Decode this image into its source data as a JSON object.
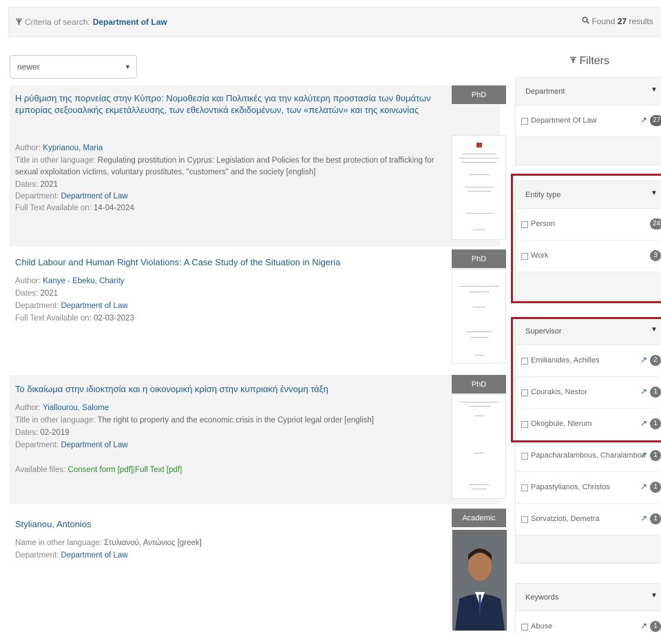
{
  "criteria": {
    "label": "Criteria of search:",
    "term": "Department of Law",
    "found_prefix": "Found",
    "found_count": "27",
    "found_suffix": "results"
  },
  "sort": {
    "selected": "newer"
  },
  "filters_title": "Filters",
  "results": [
    {
      "badge": "PhD",
      "title": "Η ρύθμιση της πορνείας στην Κύπρο: Νομοθεσία και Πολιτικές για την καλύτερη προστασία των θυμάτων εμπορίας σεξουαλικής εκμετάλλευσης, των εθελοντικά εκδιδομένων, των «πελατών» και της κοινωνίας",
      "author_label": "Author:",
      "author": "Kyprianou, Maria",
      "other_label": "Title in other language:",
      "other": "Regulating prostitution in Cyprus: Legislation and Policies for the best protection of trafficking for sexual exploitation victims, voluntary prostitutes, \"customers\" and the society [english]",
      "dates_label": "Dates:",
      "dates": "2021",
      "dept_label": "Department:",
      "dept": "Department of Law",
      "fulltext_label": "Full Text Available on:",
      "fulltext": "14-04-2024"
    },
    {
      "badge": "PhD",
      "title": "Child Labour and Human Right Violations: A Case Study of the Situation in Nigeria",
      "author_label": "Author:",
      "author": "Kanye - Ebeku, Charity",
      "dates_label": "Dates:",
      "dates": "2021",
      "dept_label": "Department:",
      "dept": "Department of Law",
      "fulltext_label": "Full Text Available on:",
      "fulltext": "02-03-2023"
    },
    {
      "badge": "PhD",
      "title": "Το δικαίωμα στην ιδιοκτησία και η οικονομική κρίση στην κυπριακή έννομη τάξη",
      "author_label": "Author:",
      "author": "Yiallourou, Salome",
      "other_label": "Title in other language:",
      "other": "The right to property and the economic crisis in the Cypriot legal order [english]",
      "dates_label": "Dates:",
      "dates": "02-2019",
      "dept_label": "Department:",
      "dept": "Department of Law",
      "files_label": "Available files:",
      "file1": "Consent form [pdf]",
      "file_sep": "|",
      "file2": "Full Text [pdf]"
    },
    {
      "badge": "Academic",
      "title": "Stylianou, Antonios",
      "other_label": "Name in other language:",
      "other": "Στυλιανού, Αντώνιος [greek]",
      "dept_label": "Department:",
      "dept": "Department of Law"
    }
  ],
  "facets": {
    "department": {
      "title": "Department",
      "items": [
        {
          "label": "Department Of Law",
          "count": "27"
        }
      ]
    },
    "entity_type": {
      "title": "Entity type",
      "items": [
        {
          "label": "Person",
          "count": "24"
        },
        {
          "label": "Work",
          "count": "3"
        }
      ]
    },
    "supervisor": {
      "title": "Supervisor",
      "items": [
        {
          "label": "Emilianides, Achilles",
          "count": "2"
        },
        {
          "label": "Courakis, Nestor",
          "count": "1"
        },
        {
          "label": "Okogbule, Nlerum",
          "count": "1"
        },
        {
          "label": "Papacharalambous, Charalambos",
          "count": "1"
        },
        {
          "label": "Papastylianos, Christos",
          "count": "1"
        },
        {
          "label": "Sorvatzioti, Demetra",
          "count": "1"
        }
      ]
    },
    "keywords": {
      "title": "Keywords",
      "items": [
        {
          "label": "Abuse",
          "count": "1"
        }
      ]
    }
  },
  "icons": {
    "filter": "funnel-icon",
    "search": "magnifier-icon",
    "external": "external-link-icon",
    "chevron": "chevron-down-icon"
  },
  "colors": {
    "link": "#1f5f8b",
    "badge": "#777777",
    "highlight": "#b0202a",
    "file_link": "#2e8b2e"
  }
}
